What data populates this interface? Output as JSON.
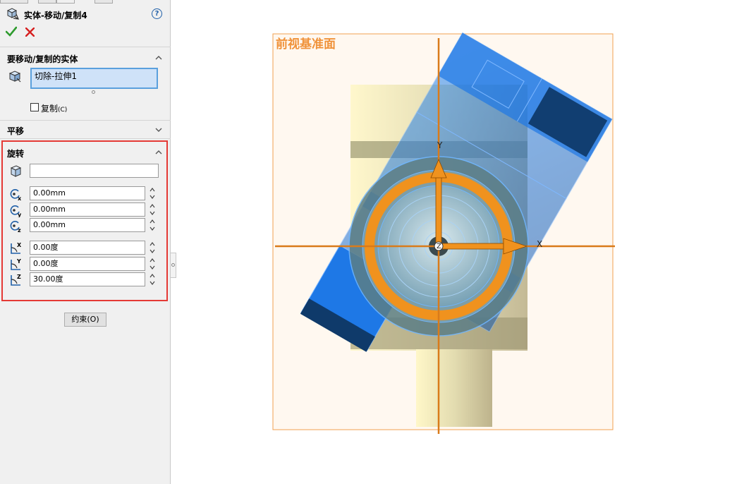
{
  "property_manager": {
    "title": "实体-移动/复制4",
    "help_icon_text": "?",
    "bodies_group": {
      "header": "要移动/复制的实体",
      "selected_items": [
        "切除-拉伸1"
      ],
      "copy_checkbox": {
        "label": "复制",
        "shortcut": "(C)",
        "checked": false
      }
    },
    "translate_group": {
      "header": "平移"
    },
    "rotate_group": {
      "header": "旋转",
      "reference_field": "",
      "center_x": "0.00mm",
      "center_y": "0.00mm",
      "center_z": "0.00mm",
      "angle_x": "0.00度",
      "angle_y": "0.00度",
      "angle_z": "30.00度",
      "axis_labels": {
        "x": "x",
        "y": "y",
        "z": "z",
        "X": "X",
        "Y": "Y",
        "Z": "Z"
      }
    },
    "constraints_button": "约束(O)"
  },
  "viewport": {
    "plane_label": "前视基准面",
    "triad": {
      "x_label": "X",
      "y_label": "Y",
      "z_label": "Z"
    },
    "colors": {
      "plane": "#f0a050",
      "plane_fill": "#fff8f0",
      "axis": "#d97b1a",
      "body_blue": "#1e78e6",
      "body_dark": "#0f3a6a",
      "body_cream": "#e8e0b8",
      "ring_orange": "#f0921e"
    }
  }
}
